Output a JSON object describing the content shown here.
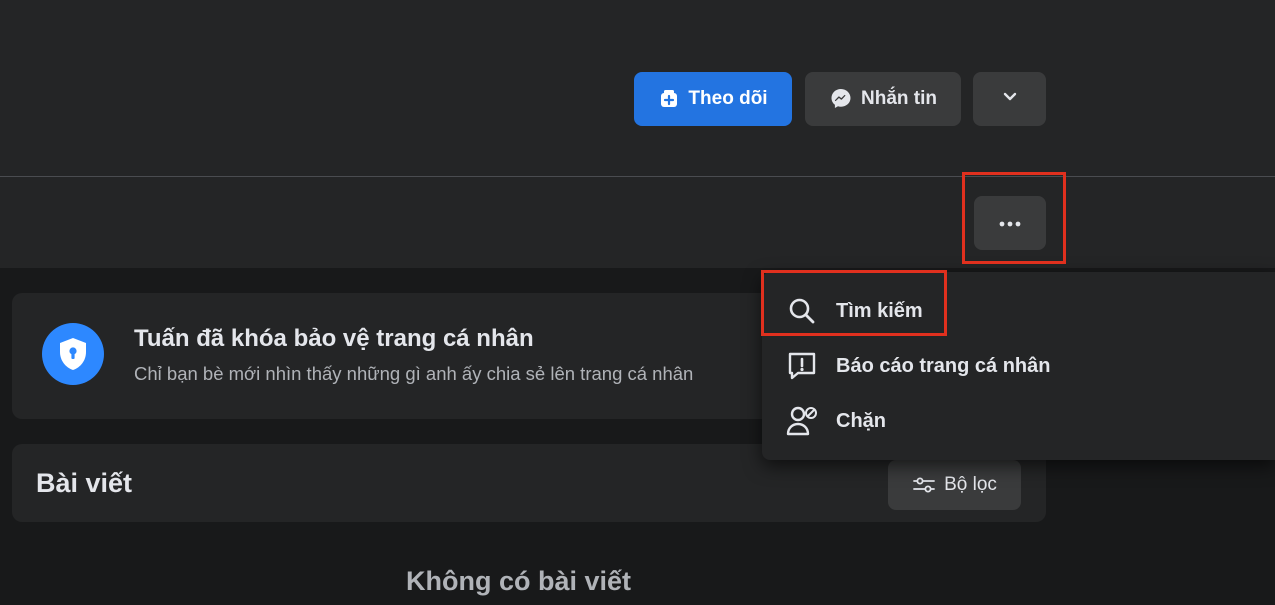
{
  "profile_actions": {
    "follow_label": "Theo dõi",
    "message_label": "Nhắn tin"
  },
  "lock_notice": {
    "title": "Tuấn đã khóa bảo vệ trang cá nhân",
    "subtitle": "Chỉ bạn bè mới nhìn thấy những gì anh ấy chia sẻ lên trang cá nhân"
  },
  "posts": {
    "title": "Bài viết",
    "filter_label": "Bộ lọc",
    "empty_label": "Không có bài viết"
  },
  "menu": {
    "items": [
      {
        "label": "Tìm kiếm",
        "icon": "search-icon"
      },
      {
        "label": "Báo cáo trang cá nhân",
        "icon": "report-icon"
      },
      {
        "label": "Chặn",
        "icon": "block-user-icon"
      }
    ]
  },
  "colors": {
    "accent": "#2374e1",
    "highlight": "#e0301e",
    "background": "#18191a",
    "surface": "#242526"
  }
}
